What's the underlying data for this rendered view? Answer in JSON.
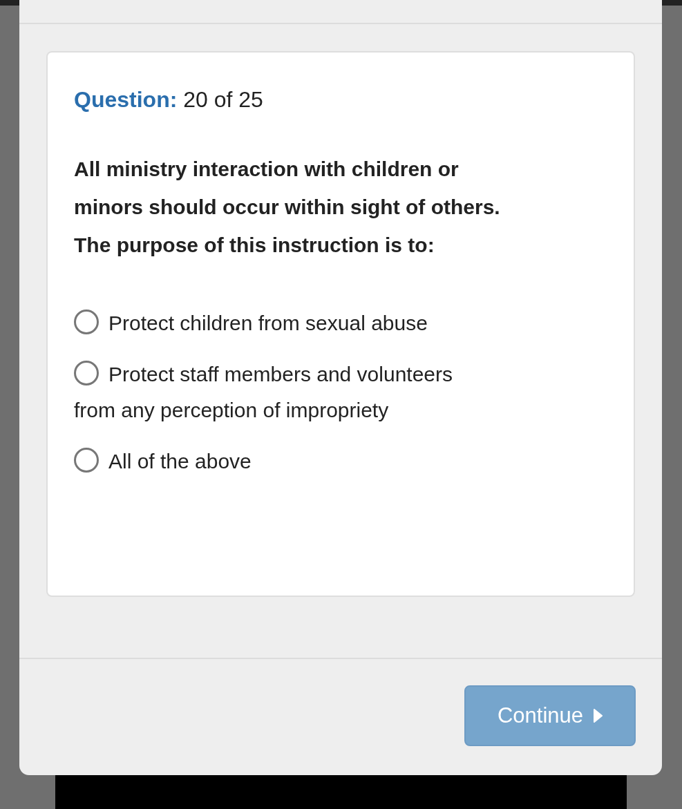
{
  "question": {
    "label": "Question:",
    "counter": "20 of 25",
    "text": "All ministry interaction with children or minors should occur within sight of others. The purpose of this instruction is to:"
  },
  "options": [
    {
      "label": "Protect children from sexual abuse",
      "selected": false
    },
    {
      "label": "Protect staff members and volunteers from any perception of impropriety",
      "selected": false
    },
    {
      "label": "All of the above",
      "selected": false
    }
  ],
  "continue_button": {
    "label": "Continue"
  }
}
